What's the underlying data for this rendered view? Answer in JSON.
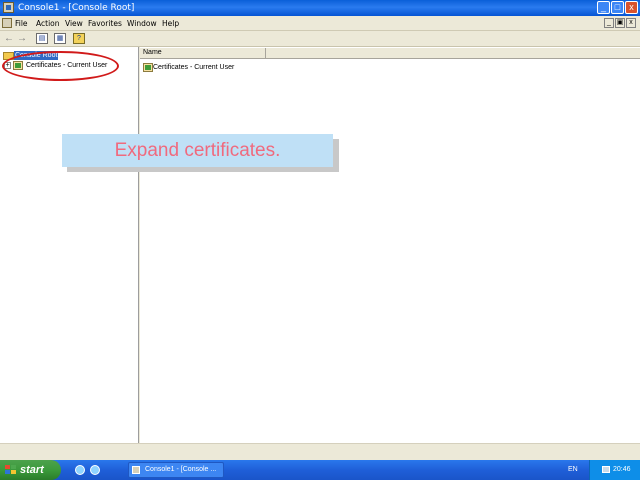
{
  "window": {
    "title": "Console1 - [Console Root]",
    "controls": {
      "minimize": "_",
      "maximize": "□",
      "close": "x"
    }
  },
  "menubar": {
    "items": [
      "File",
      "Action",
      "View",
      "Favorites",
      "Window",
      "Help"
    ],
    "child_controls": {
      "minimize": "_",
      "restore": "▣",
      "close": "x"
    }
  },
  "toolbar": {
    "back": "←",
    "forward": "→",
    "show_hide_tree": "▤",
    "properties": "▦",
    "help": "?"
  },
  "tree": {
    "root": {
      "label": "Console Root"
    },
    "children": [
      {
        "label": "Certificates - Current User",
        "expander": "+"
      }
    ]
  },
  "list": {
    "columns": [
      "Name"
    ],
    "rows": [
      "Certificates - Current User"
    ]
  },
  "annotation": {
    "instruction": "Expand certificates."
  },
  "taskbar": {
    "start_label": "start",
    "task": "Console1 - [Console ...",
    "language": "EN",
    "clock": "20:46"
  },
  "colors": {
    "titlebar": "#0a5fd8",
    "selection": "#316ac5",
    "annotation_circle": "#d11a1a",
    "callout_bg": "#bfe0f6",
    "callout_text": "#f06a7e",
    "start_green": "#3b9a3b"
  }
}
